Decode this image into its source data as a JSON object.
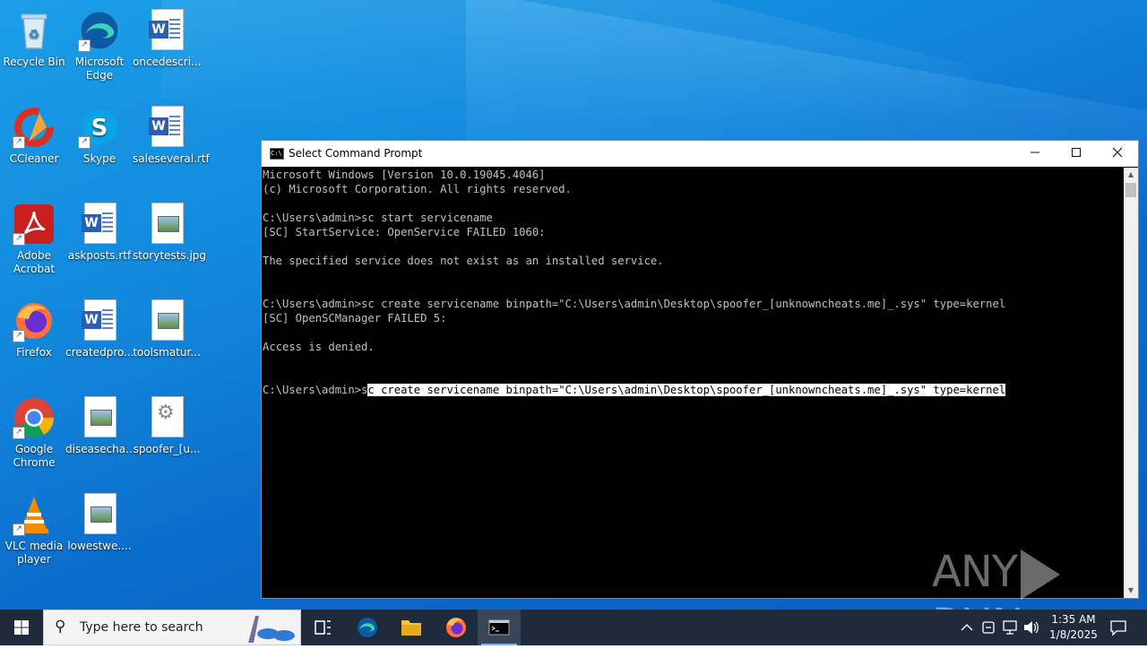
{
  "desktop_icons": [
    {
      "label": "Recycle Bin",
      "icon": "recycle-bin-icon"
    },
    {
      "label": "Microsoft Edge",
      "icon": "edge-icon"
    },
    {
      "label": "oncedescri...",
      "icon": "word-doc-icon"
    },
    {
      "label": "CCleaner",
      "icon": "ccleaner-icon"
    },
    {
      "label": "Skype",
      "icon": "skype-icon"
    },
    {
      "label": "saleseveral.rtf",
      "icon": "word-doc-icon"
    },
    {
      "label": "Adobe Acrobat",
      "icon": "acrobat-icon"
    },
    {
      "label": "askposts.rtf",
      "icon": "word-doc-icon"
    },
    {
      "label": "storytests.jpg",
      "icon": "image-file-icon"
    },
    {
      "label": "Firefox",
      "icon": "firefox-icon"
    },
    {
      "label": "createdpro...",
      "icon": "word-doc-icon"
    },
    {
      "label": "toolsmatur...",
      "icon": "image-file-icon"
    },
    {
      "label": "Google Chrome",
      "icon": "chrome-icon"
    },
    {
      "label": "diseasecha...",
      "icon": "image-file-icon"
    },
    {
      "label": "spoofer_[u...",
      "icon": "system-file-icon"
    },
    {
      "label": "VLC media player",
      "icon": "vlc-icon"
    },
    {
      "label": "lowestwe....",
      "icon": "image-file-icon"
    }
  ],
  "window": {
    "title": "Select Command Prompt",
    "console_lines": [
      "Microsoft Windows [Version 10.0.19045.4046]",
      "(c) Microsoft Corporation. All rights reserved.",
      "",
      "C:\\Users\\admin>sc start servicename",
      "[SC] StartService: OpenService FAILED 1060:",
      "",
      "The specified service does not exist as an installed service.",
      "",
      "",
      "C:\\Users\\admin>sc create servicename binpath=\"C:\\Users\\admin\\Desktop\\spoofer_[unknowncheats.me]_.sys\" type=kernel",
      "[SC] OpenSCManager FAILED 5:",
      "",
      "Access is denied.",
      "",
      ""
    ],
    "last_prompt": "C:\\Users\\admin>s",
    "selected_text": "c create servicename binpath=\"C:\\Users\\admin\\Desktop\\spoofer_[unknowncheats.me]_.sys\" type=kernel"
  },
  "watermark": {
    "left": "ANY",
    "right": "RUN"
  },
  "taskbar": {
    "search_placeholder": "Type here to search",
    "time": "1:35 AM",
    "date": "1/8/2025"
  },
  "colors": {
    "accent": "#0a6ccc",
    "taskbar": "#1f2b3a"
  }
}
